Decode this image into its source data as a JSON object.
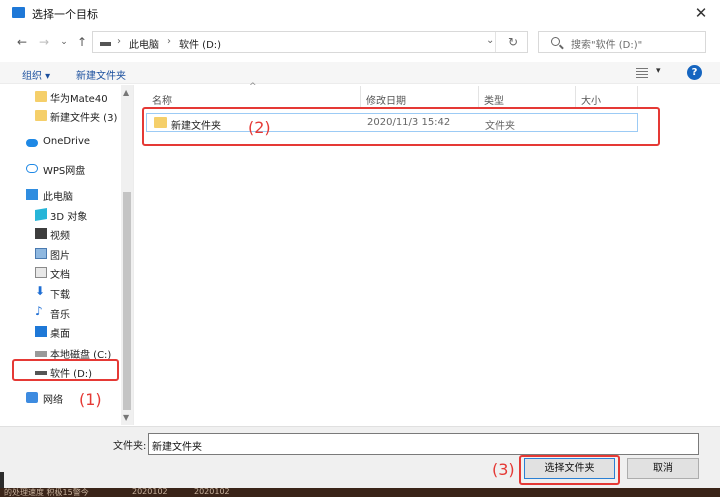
{
  "window": {
    "title": "选择一个目标",
    "close_glyph": "✕"
  },
  "nav": {
    "back": "←",
    "forward": "→",
    "recent": "⌄",
    "up": "↑"
  },
  "address": {
    "segments": [
      "此电脑",
      "软件 (D:)"
    ],
    "separator": "›",
    "dropdown": "⌄",
    "refresh": "↻"
  },
  "search": {
    "placeholder": "搜索\"软件 (D:)\""
  },
  "toolbar": {
    "organize": "组织 ▾",
    "new_folder": "新建文件夹",
    "view_chev": "▾",
    "help": "?"
  },
  "sidebar": {
    "items": [
      {
        "label": "华为Mate40",
        "icon": "folder-icon"
      },
      {
        "label": "新建文件夹 (3)",
        "icon": "folder-icon"
      },
      {
        "label": "OneDrive",
        "icon": "cloud-icon"
      },
      {
        "label": "WPS网盘",
        "icon": "wps-cloud-icon"
      },
      {
        "label": "此电脑",
        "icon": "pc-icon"
      },
      {
        "label": "3D 对象",
        "icon": "cube-icon"
      },
      {
        "label": "视频",
        "icon": "video-icon"
      },
      {
        "label": "图片",
        "icon": "picture-icon"
      },
      {
        "label": "文档",
        "icon": "document-icon"
      },
      {
        "label": "下载",
        "icon": "download-icon"
      },
      {
        "label": "音乐",
        "icon": "music-icon"
      },
      {
        "label": "桌面",
        "icon": "desktop-icon"
      },
      {
        "label": "本地磁盘 (C:)",
        "icon": "disk-icon"
      },
      {
        "label": "软件 (D:)",
        "icon": "drive-icon"
      },
      {
        "label": "网络",
        "icon": "network-icon"
      }
    ]
  },
  "columns": {
    "name": "名称",
    "modified": "修改日期",
    "type": "类型",
    "size": "大小",
    "sort_arrow": "^"
  },
  "files": [
    {
      "name": "新建文件夹",
      "modified": "2020/11/3 15:42",
      "type": "文件夹",
      "size": ""
    }
  ],
  "annotations": {
    "label1": "(1)",
    "label2": "(2)",
    "label3": "(3)",
    "color": "#e53935"
  },
  "footer": {
    "filename_label": "文件夹:",
    "filename_value": "新建文件夹",
    "select_button": "选择文件夹",
    "cancel_button": "取消"
  },
  "background_strip": {
    "left": "的处理速度  积极15警今",
    "date1": "2020102",
    "date2": "2020102"
  },
  "colors": {
    "accent": "#1e78d7",
    "link": "#1a4f9e",
    "annotation": "#e53935",
    "folder": "#f5cf6a"
  }
}
